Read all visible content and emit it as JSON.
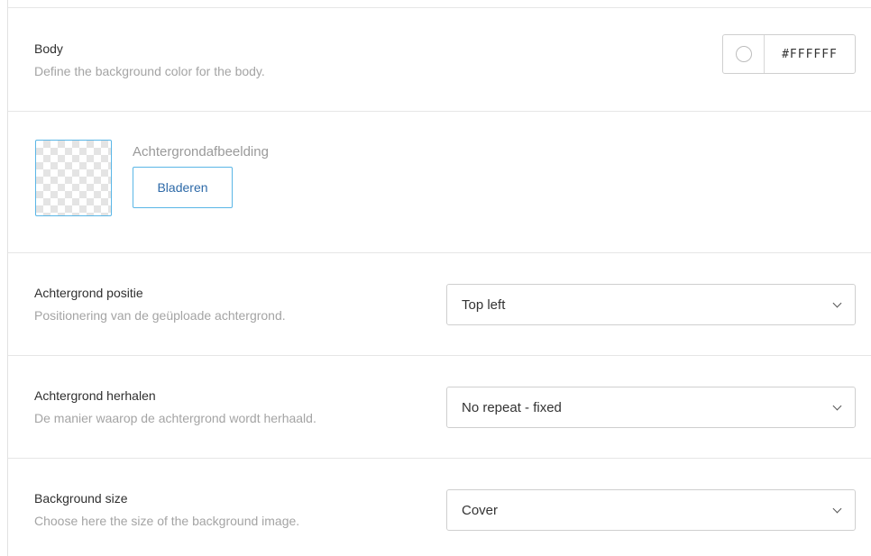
{
  "body_section": {
    "label": "Body",
    "description": "Define the background color for the body.",
    "color_value": "#FFFFFF",
    "swatch_color": "#FFFFFF"
  },
  "image_section": {
    "label": "Achtergrondafbeelding",
    "browse_label": "Bladeren"
  },
  "position_section": {
    "label": "Achtergrond positie",
    "description": "Positionering van de geüploade achtergrond.",
    "selected": "Top left"
  },
  "repeat_section": {
    "label": "Achtergrond herhalen",
    "description": "De manier waarop de achtergrond wordt herhaald.",
    "selected": "No repeat - fixed"
  },
  "size_section": {
    "label": "Background size",
    "description": "Choose here the size of the background image.",
    "selected": "Cover"
  },
  "colors": {
    "accent_border": "#5AB6E6",
    "button_text": "#2E6AA8",
    "muted_text": "#A4A4A4"
  }
}
